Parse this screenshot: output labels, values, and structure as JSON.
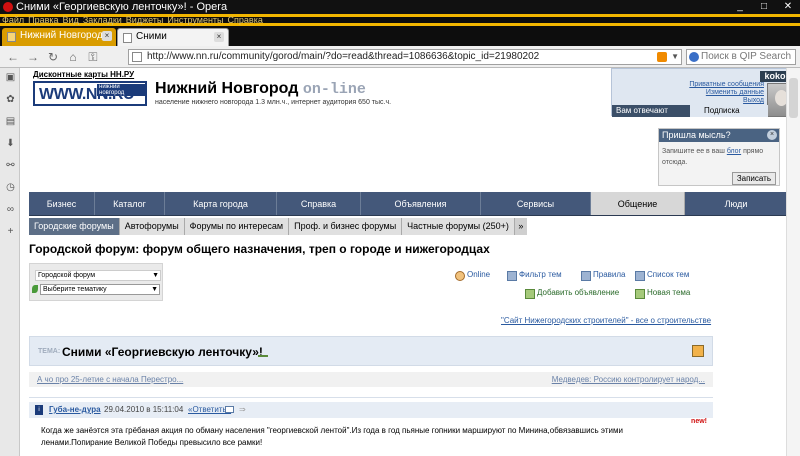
{
  "window": {
    "title": "Сними «Георгиевскую ленточку»! - Opera",
    "controls": [
      "_",
      "□",
      "✕"
    ]
  },
  "menubar": [
    "Файл",
    "Правка",
    "Вид",
    "Закладки",
    "Виджеты",
    "Инструменты",
    "Справка"
  ],
  "tabs": [
    {
      "label": "Нижний Новгород О...",
      "close": "×"
    },
    {
      "label": "Сними 'Георгиевску...",
      "close": "×"
    }
  ],
  "address": {
    "url": "http://www.nn.ru/community/gorod/main/?do=read&thread=1086636&topic_id=21980202",
    "search_placeholder": "Поиск в QIP Search"
  },
  "header": {
    "discount_link": "Дисконтные карты НН.РУ",
    "logo_text": "WWW.NN.RU",
    "logo_tag": "нижний новгород",
    "site_name": "Нижний Новгород",
    "site_online": "on-line",
    "tagline": "население нижнего новгорода 1.3 млн.ч., интернет аудитория 650 тыс.ч."
  },
  "user": {
    "name": "kokon",
    "links": [
      "Приватные сообщения",
      "Изменить данные",
      "Выход"
    ],
    "tab_answers": "Вам отвечают",
    "tab_subscription": "Подписка"
  },
  "ideabox": {
    "title": "Пришла мысль?",
    "close": "×",
    "text_before": "Запишите ее в ваш ",
    "blog": "блог",
    "text_after": " прямо отсюда.",
    "button": "Записать"
  },
  "mainnav": [
    {
      "label": "Бизнес",
      "w": 66
    },
    {
      "label": "Каталог",
      "w": 70
    },
    {
      "label": "Карта города",
      "w": 112
    },
    {
      "label": "Справка",
      "w": 84
    },
    {
      "label": "Объявления",
      "w": 120
    },
    {
      "label": "Сервисы",
      "w": 110
    },
    {
      "label": "Общение",
      "w": 94
    },
    {
      "label": "Люди",
      "w": 103
    }
  ],
  "subnav": [
    "Городские форумы",
    "Автофорумы",
    "Форумы по интересам",
    "Проф. и бизнес форумы",
    "Частные форумы (250+)"
  ],
  "subnav_more": "»",
  "page_title": "Городской форум: форум общего назначения, треп о городе и нижегородцах",
  "filters": {
    "forum_select": "Городской форум",
    "topic_select": "Выберите тематику"
  },
  "toplinks": {
    "online": "Online",
    "filter": "Фильтр тем",
    "rules": "Правила",
    "list": "Список тем",
    "add_ad": "Добавить объявление",
    "new_topic": "Новая тема"
  },
  "builders_link": "\"Сайт Нижегородских строителей\" - все о строительстве",
  "topic": {
    "label": "ТЕМА:",
    "title": "Сними «Георгиевскую ленточку»!"
  },
  "prevnext": {
    "prev": "А чо про 25-летие с начала Перестро...",
    "next": "Медведев: Россию контролирует народ..."
  },
  "post": {
    "author": "Губа-не-дура",
    "date": "29.04.2010 в 15:11:04",
    "reply": "«Ответить»",
    "new_label": "new!",
    "body": "Когда же занёэтся эта грёбаная акция по обману населения \"георгиевской лентой\".Из года в год пьяные гопники маршируют по Минина,обвязавшись этими ленами.Попирание Великой Победы превысило все рамки!"
  }
}
